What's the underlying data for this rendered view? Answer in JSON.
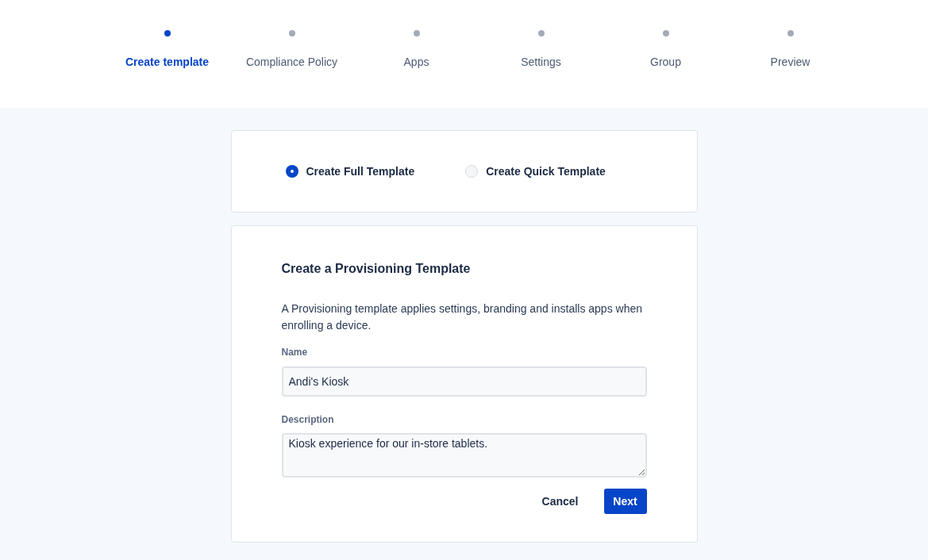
{
  "steps": [
    {
      "label": "Create template",
      "selected": true
    },
    {
      "label": "Compliance Policy",
      "selected": false
    },
    {
      "label": "Apps",
      "selected": false
    },
    {
      "label": "Settings",
      "selected": false
    },
    {
      "label": "Group",
      "selected": false
    },
    {
      "label": "Preview",
      "selected": false
    }
  ],
  "template_type": [
    {
      "label": "Create Full Template",
      "selected": true
    },
    {
      "label": "Create Quick Template",
      "selected": false
    }
  ],
  "form": {
    "title": "Create a Provisioning Template",
    "description": "A Provisioning template applies settings, branding and installs apps when enrolling a device.",
    "name": {
      "label": "Name",
      "value": "Andi's Kiosk"
    },
    "description_field": {
      "label": "Description",
      "value": "Kiosk experience for our in-store tablets."
    },
    "buttons": {
      "cancel": "Cancel",
      "next": "Next"
    }
  }
}
